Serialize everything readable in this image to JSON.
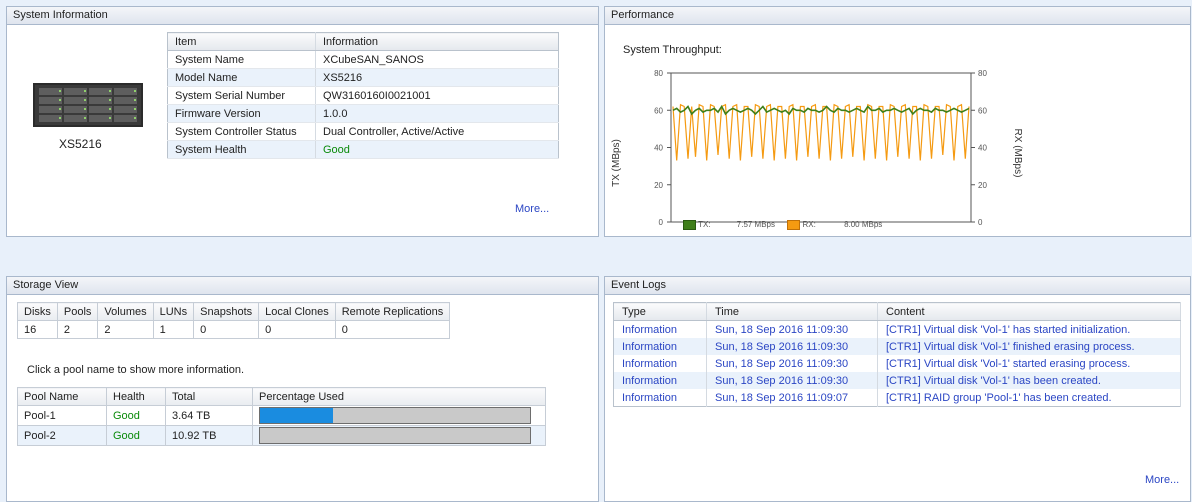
{
  "system_info": {
    "header": "System Information",
    "device_label": "XS5216",
    "table_headers": [
      "Item",
      "Information"
    ],
    "rows": [
      {
        "item": "System Name",
        "info": "XCubeSAN_SANOS"
      },
      {
        "item": "Model Name",
        "info": "XS5216"
      },
      {
        "item": "System Serial Number",
        "info": "QW3160160I0021001"
      },
      {
        "item": "Firmware Version",
        "info": "1.0.0"
      },
      {
        "item": "System Controller Status",
        "info": "Dual Controller, Active/Active"
      },
      {
        "item": "System Health",
        "info": "Good"
      }
    ],
    "more": "More..."
  },
  "performance": {
    "header": "Performance",
    "chart_title": "System Throughput:",
    "left_axis_label": "TX (MBps)",
    "right_axis_label": "RX (MBps)",
    "legend": {
      "tx_label": "TX:",
      "tx_value": "7.57 MBps",
      "rx_label": "RX:",
      "rx_value": "8.00 MBps"
    }
  },
  "chart_data": {
    "type": "line",
    "title": "System Throughput:",
    "ylabel": "TX (MBps)",
    "y2label": "RX (MBps)",
    "ylim": [
      0,
      80
    ],
    "yticks": [
      "0",
      "20",
      "40",
      "60",
      "80"
    ],
    "grid": false,
    "legend_position": "bottom-left",
    "colors": {
      "tx": "#3f7f1a",
      "rx": "#f59a11"
    },
    "series": [
      {
        "name": "TX",
        "values": [
          60,
          61,
          59,
          60,
          62,
          58,
          60,
          61,
          59,
          60,
          60,
          61,
          59,
          62,
          58,
          60,
          61,
          60,
          59,
          60,
          61,
          60,
          58,
          60,
          62,
          59,
          60,
          61,
          60,
          59,
          60,
          58,
          61,
          60,
          60,
          59,
          61,
          60,
          60,
          59,
          60,
          62,
          60,
          59,
          61,
          60,
          60,
          59,
          60,
          61,
          60,
          59,
          62,
          60,
          60,
          61,
          59,
          60,
          60,
          61,
          60,
          59,
          60,
          61,
          58,
          60,
          61,
          60,
          60,
          59,
          61,
          60,
          60,
          59,
          60,
          61,
          60,
          59,
          60,
          61
        ]
      },
      {
        "name": "RX",
        "values": [
          62,
          33,
          63,
          62,
          34,
          62,
          35,
          63,
          62,
          33,
          63,
          62,
          36,
          62,
          63,
          34,
          62,
          63,
          33,
          62,
          62,
          35,
          63,
          62,
          34,
          62,
          63,
          33,
          62,
          62,
          34,
          62,
          63,
          33,
          62,
          62,
          35,
          62,
          63,
          34,
          62,
          62,
          33,
          63,
          62,
          34,
          62,
          63,
          35,
          62,
          62,
          33,
          63,
          62,
          34,
          62,
          62,
          33,
          63,
          62,
          35,
          62,
          63,
          34,
          62,
          62,
          33,
          63,
          62,
          34,
          62,
          62,
          36,
          63,
          62,
          33,
          62,
          63,
          34,
          62
        ]
      }
    ]
  },
  "storage": {
    "header": "Storage View",
    "summary_headers": [
      "Disks",
      "Pools",
      "Volumes",
      "LUNs",
      "Snapshots",
      "Local Clones",
      "Remote Replications"
    ],
    "summary_values": [
      "16",
      "2",
      "2",
      "1",
      "0",
      "0",
      "0"
    ],
    "hint": "Click a pool name to show more information.",
    "pool_headers": [
      "Pool Name",
      "Health",
      "Total",
      "Percentage Used"
    ],
    "pools": [
      {
        "name": "Pool-1",
        "health": "Good",
        "total": "3.64 TB",
        "used_fraction": 0.27
      },
      {
        "name": "Pool-2",
        "health": "Good",
        "total": "10.92 TB",
        "used_fraction": 0.0
      }
    ]
  },
  "events": {
    "header": "Event Logs",
    "headers": [
      "Type",
      "Time",
      "Content"
    ],
    "rows": [
      {
        "type": "Information",
        "time": "Sun, 18 Sep 2016 11:09:30",
        "content": "[CTR1] Virtual disk 'Vol-1' has started initialization."
      },
      {
        "type": "Information",
        "time": "Sun, 18 Sep 2016 11:09:30",
        "content": "[CTR1] Virtual disk 'Vol-1' finished erasing process."
      },
      {
        "type": "Information",
        "time": "Sun, 18 Sep 2016 11:09:30",
        "content": "[CTR1] Virtual disk 'Vol-1' started erasing process."
      },
      {
        "type": "Information",
        "time": "Sun, 18 Sep 2016 11:09:30",
        "content": "[CTR1] Virtual disk 'Vol-1' has been created."
      },
      {
        "type": "Information",
        "time": "Sun, 18 Sep 2016 11:09:07",
        "content": "[CTR1] RAID group 'Pool-1' has been created."
      }
    ],
    "more": "More..."
  }
}
